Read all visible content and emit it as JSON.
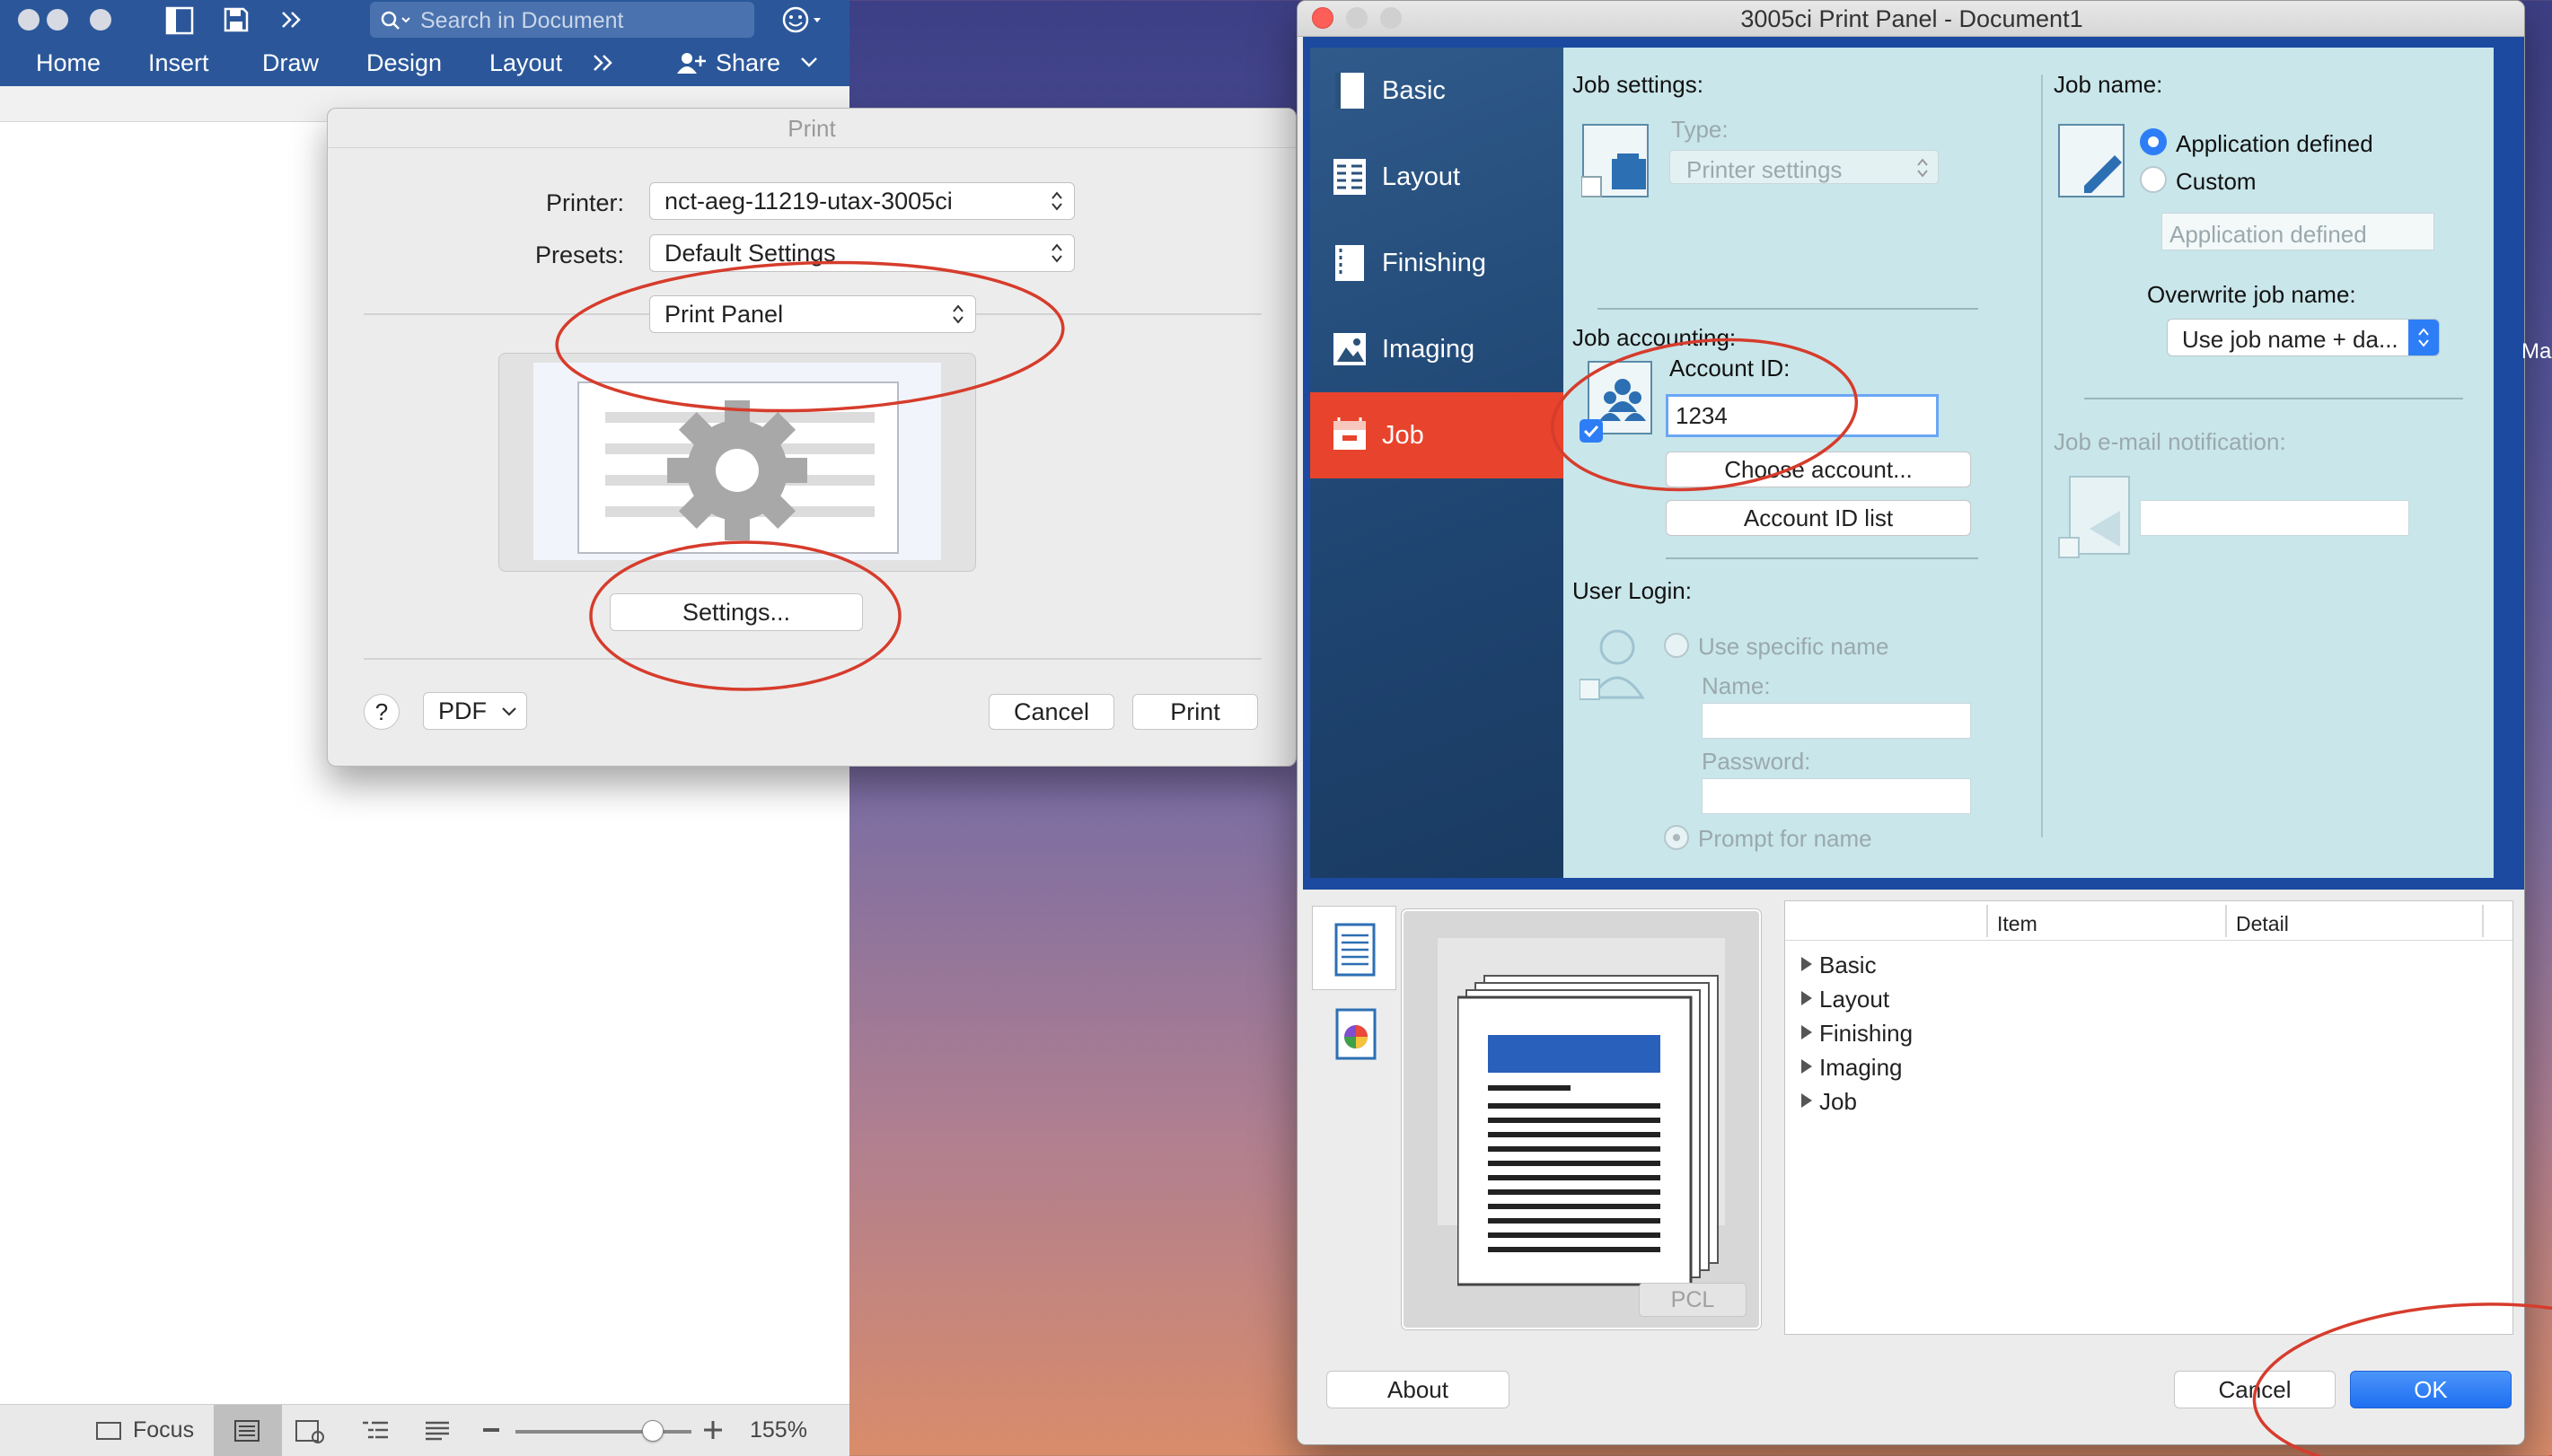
{
  "word": {
    "search_placeholder": "Search in Document",
    "ribbon_tabs": [
      "Home",
      "Insert",
      "Draw",
      "Design",
      "Layout"
    ],
    "share_label": "Share",
    "status_focus": "Focus",
    "zoom_text": "155%",
    "zoom_level": 0.78
  },
  "print_dialog": {
    "title": "Print",
    "printer_label": "Printer:",
    "printer_value": "nct-aeg-11219-utax-3005ci",
    "presets_label": "Presets:",
    "presets_value": "Default Settings",
    "section_value": "Print Panel",
    "settings_button": "Settings...",
    "help_label": "?",
    "pdf_label": "PDF",
    "cancel_label": "Cancel",
    "print_label": "Print"
  },
  "print_panel": {
    "title": "3005ci Print Panel - Document1",
    "nav": [
      {
        "label": "Basic",
        "icon": "basic-icon"
      },
      {
        "label": "Layout",
        "icon": "layout-icon"
      },
      {
        "label": "Finishing",
        "icon": "finishing-icon"
      },
      {
        "label": "Imaging",
        "icon": "imaging-icon"
      },
      {
        "label": "Job",
        "icon": "job-icon",
        "selected": true
      }
    ],
    "job_settings": {
      "heading": "Job settings:",
      "type_label": "Type:",
      "type_value": "Printer settings"
    },
    "job_accounting": {
      "heading": "Job accounting:",
      "account_label": "Account ID:",
      "account_value": "1234",
      "choose_button": "Choose account...",
      "list_button": "Account ID list",
      "checked": true
    },
    "user_login": {
      "heading": "User Login:",
      "use_specific": "Use specific name",
      "name_label": "Name:",
      "password_label": "Password:",
      "prompt": "Prompt for name"
    },
    "job_name": {
      "heading": "Job name:",
      "opt_app": "Application defined",
      "opt_custom": "Custom",
      "field_placeholder": "Application defined",
      "overwrite_label": "Overwrite job name:",
      "overwrite_value": "Use job name + da..."
    },
    "email": {
      "heading": "Job e-mail notification:"
    },
    "preview_badge": "PCL",
    "table": {
      "col_item": "Item",
      "col_detail": "Detail",
      "rows": [
        "Basic",
        "Layout",
        "Finishing",
        "Imaging",
        "Job"
      ]
    },
    "about_label": "About",
    "cancel_label": "Cancel",
    "ok_label": "OK",
    "edge_text": "Max"
  },
  "colors": {
    "word_blue": "#2b579a",
    "job_red": "#e8432c",
    "panel_blue": "#1b4aa0",
    "content_bg": "#c9e6ea",
    "ok_blue": "#2d7ef6",
    "annotation_red": "#d63c2c"
  }
}
